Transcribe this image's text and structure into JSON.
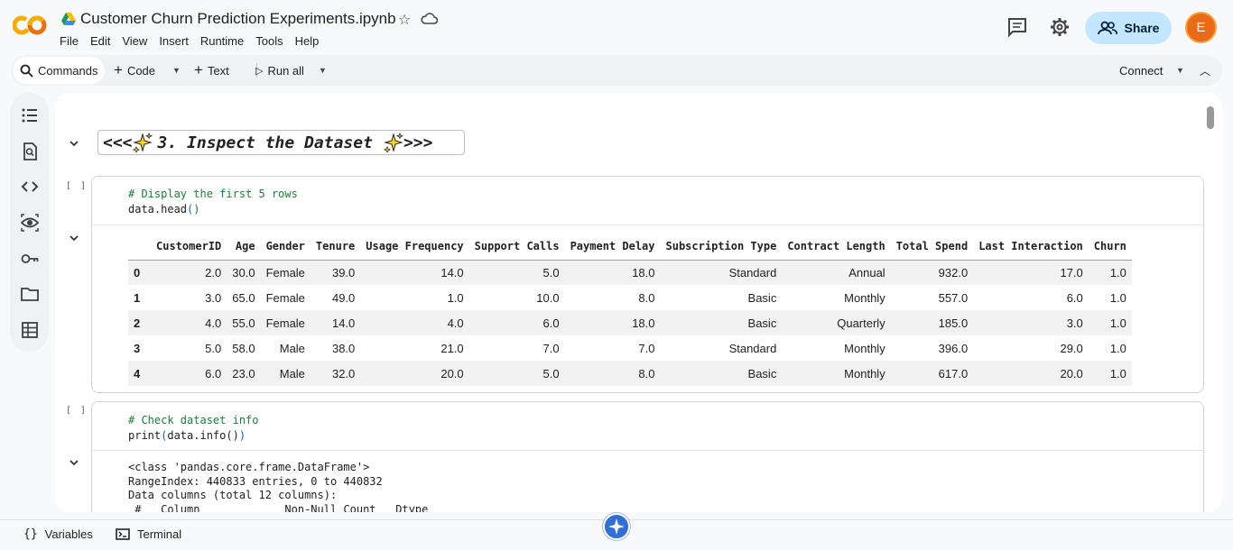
{
  "header": {
    "title": "Customer Churn Prediction Experiments.ipynb",
    "menu": [
      "File",
      "Edit",
      "View",
      "Insert",
      "Runtime",
      "Tools",
      "Help"
    ],
    "share_label": "Share",
    "avatar_letter": "E"
  },
  "toolbar": {
    "commands_label": "Commands",
    "code_label": "Code",
    "text_label": "Text",
    "run_all_label": "Run all",
    "connect_label": "Connect"
  },
  "rail_icons": [
    "table-of-contents-icon",
    "find-icon",
    "code-snippets-icon",
    "variables-inspector-icon",
    "secrets-key-icon",
    "files-folder-icon",
    "data-table-icon"
  ],
  "notebook": {
    "section_heading": "<<< ✨ 3. Inspect the Dataset ✨>>>",
    "heading_prefix": "<<<",
    "heading_text": "3. Inspect the Dataset",
    "heading_suffix": ">>>",
    "cells": [
      {
        "exec_count": "[ ]",
        "code_comment": "# Display the first 5 rows",
        "code_obj": "data.head",
        "code_parens": "()",
        "table": {
          "columns": [
            "",
            "CustomerID",
            "Age",
            "Gender",
            "Tenure",
            "Usage Frequency",
            "Support Calls",
            "Payment Delay",
            "Subscription Type",
            "Contract Length",
            "Total Spend",
            "Last Interaction",
            "Churn"
          ],
          "rows": [
            [
              "0",
              "2.0",
              "30.0",
              "Female",
              "39.0",
              "14.0",
              "5.0",
              "18.0",
              "Standard",
              "Annual",
              "932.0",
              "17.0",
              "1.0"
            ],
            [
              "1",
              "3.0",
              "65.0",
              "Female",
              "49.0",
              "1.0",
              "10.0",
              "8.0",
              "Basic",
              "Monthly",
              "557.0",
              "6.0",
              "1.0"
            ],
            [
              "2",
              "4.0",
              "55.0",
              "Female",
              "14.0",
              "4.0",
              "6.0",
              "18.0",
              "Basic",
              "Quarterly",
              "185.0",
              "3.0",
              "1.0"
            ],
            [
              "3",
              "5.0",
              "58.0",
              "Male",
              "38.0",
              "21.0",
              "7.0",
              "7.0",
              "Standard",
              "Monthly",
              "396.0",
              "29.0",
              "1.0"
            ],
            [
              "4",
              "6.0",
              "23.0",
              "Male",
              "32.0",
              "20.0",
              "5.0",
              "8.0",
              "Basic",
              "Monthly",
              "617.0",
              "20.0",
              "1.0"
            ]
          ]
        }
      },
      {
        "exec_count": "[ ]",
        "code_comment": "# Check dataset info",
        "code_fn": "print",
        "code_arg": "data.info()",
        "output_lines": [
          "<class 'pandas.core.frame.DataFrame'>",
          "RangeIndex: 440833 entries, 0 to 440832",
          "Data columns (total 12 columns):",
          " #   Column             Non-Null Count   Dtype"
        ]
      }
    ]
  },
  "bottom": {
    "variables_label": "Variables",
    "terminal_label": "Terminal"
  }
}
